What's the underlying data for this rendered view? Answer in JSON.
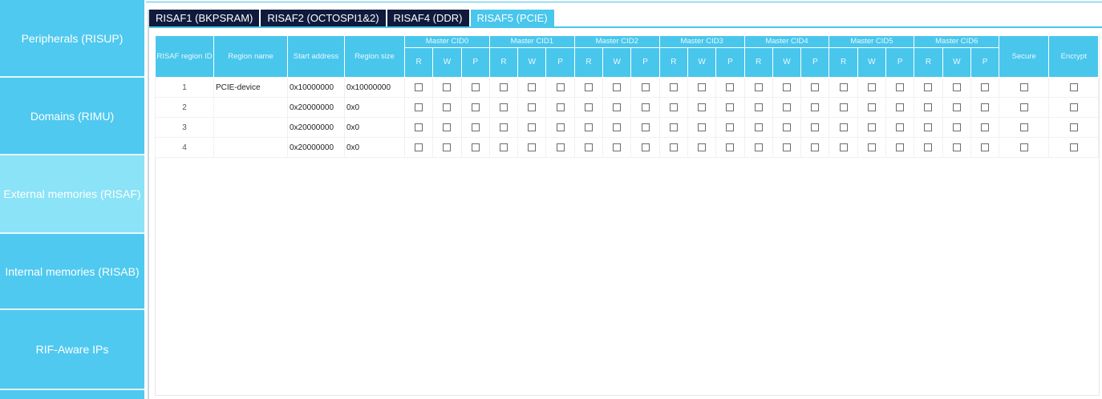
{
  "sidebar": {
    "items": [
      {
        "label": "Peripherals (RISUP)"
      },
      {
        "label": "Domains (RIMU)"
      },
      {
        "label": "External memories (RISAF)"
      },
      {
        "label": "Internal memories (RISAB)"
      },
      {
        "label": "RIF-Aware IPs"
      }
    ],
    "active_index": 2
  },
  "tabs": [
    {
      "label": "RISAF1 (BKPSRAM)"
    },
    {
      "label": "RISAF2 (OCTOSPI1&2)"
    },
    {
      "label": "RISAF4 (DDR)"
    },
    {
      "label": "RISAF5 (PCIE)"
    }
  ],
  "active_tab": 3,
  "table": {
    "headers": {
      "region_id": "RISAF region ID",
      "region_name": "Region name",
      "start_address": "Start address",
      "region_size": "Region size",
      "masters": [
        "Master CID0",
        "Master CID1",
        "Master CID2",
        "Master CID3",
        "Master CID4",
        "Master CID5",
        "Master CID6"
      ],
      "rwp": [
        "R",
        "W",
        "P"
      ],
      "secure": "Secure",
      "encrypt": "Encrypt"
    },
    "rows": [
      {
        "id": "1",
        "name": "PCIE-device",
        "start": "0x10000000",
        "size": "0x10000000"
      },
      {
        "id": "2",
        "name": "",
        "start": "0x20000000",
        "size": "0x0"
      },
      {
        "id": "3",
        "name": "",
        "start": "0x20000000",
        "size": "0x0"
      },
      {
        "id": "4",
        "name": "",
        "start": "0x20000000",
        "size": "0x0"
      }
    ]
  },
  "colors": {
    "sidebar": "#4fc9ef",
    "sidebar_active": "#8ae3f7",
    "tab_dark": "#0f1a3c",
    "accent": "#49c6ec"
  }
}
